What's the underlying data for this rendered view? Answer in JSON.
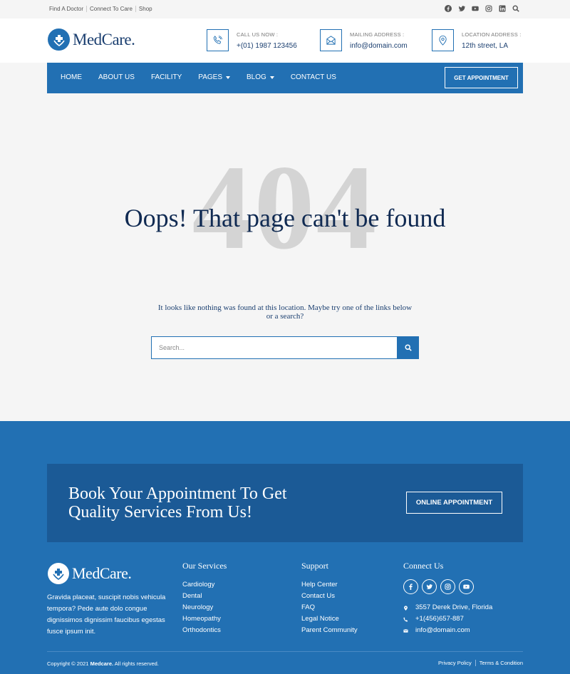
{
  "topbar": {
    "links": [
      "Find A Doctor",
      "Connect To Care",
      "Shop"
    ],
    "icons": [
      "facebook-icon",
      "twitter-icon",
      "youtube-icon",
      "instagram-icon",
      "linkedin-icon",
      "search-icon"
    ]
  },
  "header": {
    "brand": "MedCare.",
    "call": {
      "label": "CALL US NOW :",
      "value": "+(01) 1987 123456",
      "icon": "phone-icon"
    },
    "mail": {
      "label": "MAILING ADDRESS :",
      "value": "info@domain.com",
      "icon": "envelope-icon"
    },
    "location": {
      "label": "LOCATION ADDRESS :",
      "value": "12th street, LA",
      "icon": "map-pin-icon"
    }
  },
  "nav": {
    "items": [
      "HOME",
      "ABOUT US",
      "FACILITY",
      "PAGES",
      "BLOG",
      "CONTACT US"
    ],
    "appointment": "GET APPOINTMENT"
  },
  "error": {
    "code": "404",
    "title": "Oops! That page can't be found",
    "message": "It looks like nothing was found at this location. Maybe try one of the links below or a search?",
    "search_placeholder": "Search..."
  },
  "cta": {
    "title": "Book Your Appointment To Get Quality Services From Us!",
    "button": "ONLINE APPOINTMENT"
  },
  "footer": {
    "brand": "MedCare.",
    "description": "Gravida placeat, suscipit nobis vehicula tempora? Pede aute dolo congue dignissimos dignissim faucibus egestas fusce ipsum init.",
    "services": {
      "title": "Our Services",
      "items": [
        "Cardiology",
        "Dental",
        "Neurology",
        "Homeopathy",
        "Orthodontics"
      ]
    },
    "support": {
      "title": "Support",
      "items": [
        "Help Center",
        "Contact Us",
        "FAQ",
        "Legal Notice",
        "Parent Community"
      ]
    },
    "connect": {
      "title": "Connect Us",
      "social": [
        "facebook-icon",
        "twitter-icon",
        "instagram-icon",
        "youtube-icon"
      ],
      "address": "3557 Derek Drive, Florida",
      "phone": "+1(456)657-887",
      "email": "info@domain.com"
    },
    "copyright_prefix": "Copyright © 2021",
    "copyright_brand": "Medcare.",
    "copyright_suffix": "All rights reserved.",
    "legal": [
      "Privacy Policy",
      "Terms & Condition"
    ]
  },
  "colors": {
    "primary": "#2270b3",
    "dark_blue": "#1b5a96",
    "navy": "#102a52",
    "ghost": "#d4d4d4"
  }
}
